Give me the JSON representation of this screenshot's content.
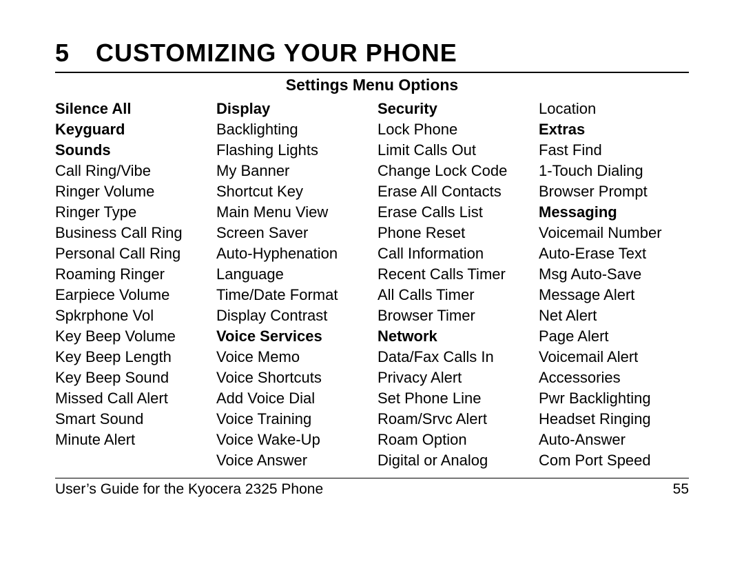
{
  "chapter": {
    "number": "5",
    "title": "CUSTOMIZING YOUR PHONE"
  },
  "section_title": "Settings Menu Options",
  "columns": [
    [
      {
        "text": "Silence All",
        "bold": true
      },
      {
        "text": "Keyguard",
        "bold": true
      },
      {
        "text": "Sounds",
        "bold": true
      },
      {
        "text": "Call Ring/Vibe",
        "bold": false
      },
      {
        "text": "Ringer Volume",
        "bold": false
      },
      {
        "text": "Ringer Type",
        "bold": false
      },
      {
        "text": "Business Call Ring",
        "bold": false
      },
      {
        "text": "Personal Call Ring",
        "bold": false
      },
      {
        "text": "Roaming Ringer",
        "bold": false
      },
      {
        "text": "Earpiece Volume",
        "bold": false
      },
      {
        "text": "Spkrphone Vol",
        "bold": false
      },
      {
        "text": "Key Beep Volume",
        "bold": false
      },
      {
        "text": "Key Beep Length",
        "bold": false
      },
      {
        "text": "Key Beep Sound",
        "bold": false
      },
      {
        "text": "Missed Call Alert",
        "bold": false
      },
      {
        "text": "Smart Sound",
        "bold": false
      },
      {
        "text": "Minute Alert",
        "bold": false
      }
    ],
    [
      {
        "text": "Display",
        "bold": true
      },
      {
        "text": "Backlighting",
        "bold": false
      },
      {
        "text": "Flashing Lights",
        "bold": false
      },
      {
        "text": "My Banner",
        "bold": false
      },
      {
        "text": "Shortcut Key",
        "bold": false
      },
      {
        "text": "Main Menu View",
        "bold": false
      },
      {
        "text": "Screen Saver",
        "bold": false
      },
      {
        "text": "Auto-Hyphenation",
        "bold": false
      },
      {
        "text": "Language",
        "bold": false
      },
      {
        "text": "Time/Date Format",
        "bold": false
      },
      {
        "text": "Display Contrast",
        "bold": false
      },
      {
        "text": "Voice Services",
        "bold": true
      },
      {
        "text": "Voice Memo",
        "bold": false
      },
      {
        "text": "Voice Shortcuts",
        "bold": false
      },
      {
        "text": "Add Voice Dial",
        "bold": false
      },
      {
        "text": "Voice Training",
        "bold": false
      },
      {
        "text": "Voice Wake-Up",
        "bold": false
      },
      {
        "text": "Voice Answer",
        "bold": false
      }
    ],
    [
      {
        "text": "Security",
        "bold": true
      },
      {
        "text": "Lock Phone",
        "bold": false
      },
      {
        "text": "Limit Calls Out",
        "bold": false
      },
      {
        "text": "Change Lock Code",
        "bold": false
      },
      {
        "text": "Erase All Contacts",
        "bold": false
      },
      {
        "text": "Erase Calls List",
        "bold": false
      },
      {
        "text": "Phone Reset",
        "bold": false
      },
      {
        "text": "Call Information",
        "bold": false
      },
      {
        "text": "Recent Calls Timer",
        "bold": false
      },
      {
        "text": "All Calls Timer",
        "bold": false
      },
      {
        "text": "Browser Timer",
        "bold": false
      },
      {
        "text": "Network",
        "bold": true
      },
      {
        "text": "Data/Fax Calls In",
        "bold": false
      },
      {
        "text": "Privacy Alert",
        "bold": false
      },
      {
        "text": "Set Phone Line",
        "bold": false
      },
      {
        "text": "Roam/Srvc Alert",
        "bold": false
      },
      {
        "text": "Roam Option",
        "bold": false
      },
      {
        "text": "Digital or Analog",
        "bold": false
      }
    ],
    [
      {
        "text": "Location",
        "bold": false
      },
      {
        "text": "Extras",
        "bold": true
      },
      {
        "text": "Fast Find",
        "bold": false
      },
      {
        "text": "1-Touch Dialing",
        "bold": false
      },
      {
        "text": "Browser Prompt",
        "bold": false
      },
      {
        "text": "Messaging",
        "bold": true
      },
      {
        "text": "Voicemail Number",
        "bold": false
      },
      {
        "text": "Auto-Erase Text",
        "bold": false
      },
      {
        "text": "Msg Auto-Save",
        "bold": false
      },
      {
        "text": "Message Alert",
        "bold": false
      },
      {
        "text": "Net Alert",
        "bold": false
      },
      {
        "text": "Page Alert",
        "bold": false
      },
      {
        "text": "Voicemail Alert",
        "bold": false
      },
      {
        "text": "Accessories",
        "bold": false
      },
      {
        "text": "Pwr Backlighting",
        "bold": false
      },
      {
        "text": "Headset Ringing",
        "bold": false
      },
      {
        "text": "Auto-Answer",
        "bold": false
      },
      {
        "text": "Com Port Speed",
        "bold": false
      }
    ]
  ],
  "footer": {
    "left": "User’s Guide for the Kyocera 2325 Phone",
    "right": "55"
  }
}
